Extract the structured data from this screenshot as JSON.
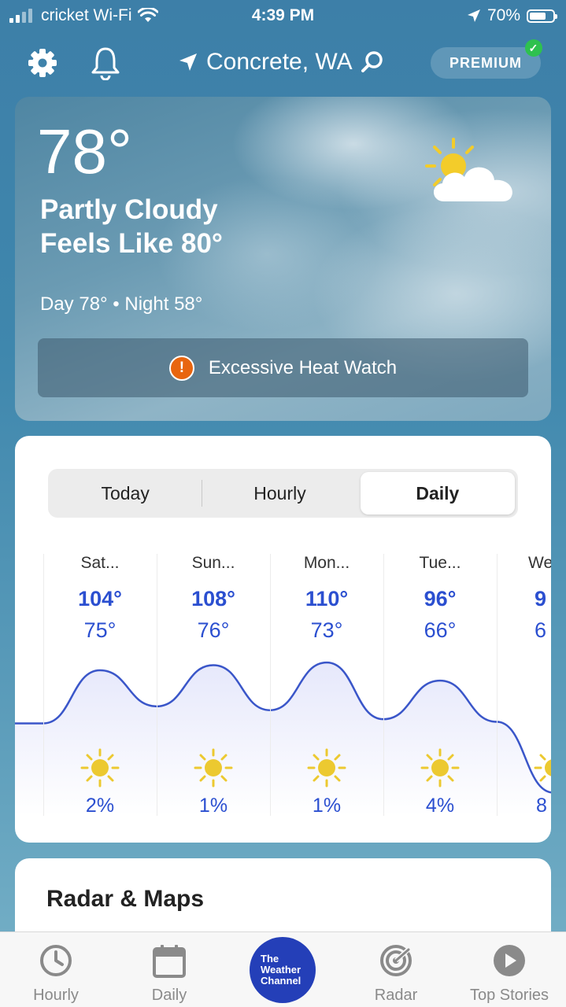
{
  "status_bar": {
    "carrier": "cricket Wi-Fi",
    "time": "4:39 PM",
    "battery": "70%",
    "battery_level": 0.7
  },
  "header": {
    "location": "Concrete, WA",
    "premium_label": "PREMIUM"
  },
  "current": {
    "temperature": "78°",
    "condition": "Partly Cloudy",
    "feels_like": "Feels Like 80°",
    "day_night": "Day 78° • Night 58°",
    "condition_icon": "partly-cloudy-icon",
    "alert": "Excessive Heat Watch"
  },
  "forecast": {
    "tabs": [
      "Today",
      "Hourly",
      "Daily"
    ],
    "active_tab": "Daily",
    "days": [
      {
        "name": "Sat...",
        "high": "104°",
        "low": "75°",
        "precip": "2%",
        "icon": "sunny-icon"
      },
      {
        "name": "Sun...",
        "high": "108°",
        "low": "76°",
        "precip": "1%",
        "icon": "sunny-icon"
      },
      {
        "name": "Mon...",
        "high": "110°",
        "low": "73°",
        "precip": "1%",
        "icon": "sunny-icon"
      },
      {
        "name": "Tue...",
        "high": "96°",
        "low": "66°",
        "precip": "4%",
        "icon": "sunny-icon"
      },
      {
        "name": "We",
        "high": "9",
        "low": "6",
        "precip": "8",
        "icon": "sunny-icon"
      }
    ]
  },
  "radar_section": {
    "title": "Radar & Maps"
  },
  "tab_bar": {
    "items": [
      {
        "label": "Hourly",
        "icon": "clock-icon"
      },
      {
        "label": "Daily",
        "icon": "calendar-icon"
      },
      {
        "label": "The Weather Channel",
        "icon": "weather-channel-logo"
      },
      {
        "label": "Radar",
        "icon": "radar-icon"
      },
      {
        "label": "Top Stories",
        "icon": "play-icon"
      }
    ],
    "logo_lines": [
      "The",
      "Weather",
      "Channel"
    ]
  },
  "colors": {
    "temperature_blue": "#2b4fd0",
    "alert_orange": "#e8650f",
    "brand_blue": "#243fb8",
    "premium_check": "#2ec14f"
  }
}
